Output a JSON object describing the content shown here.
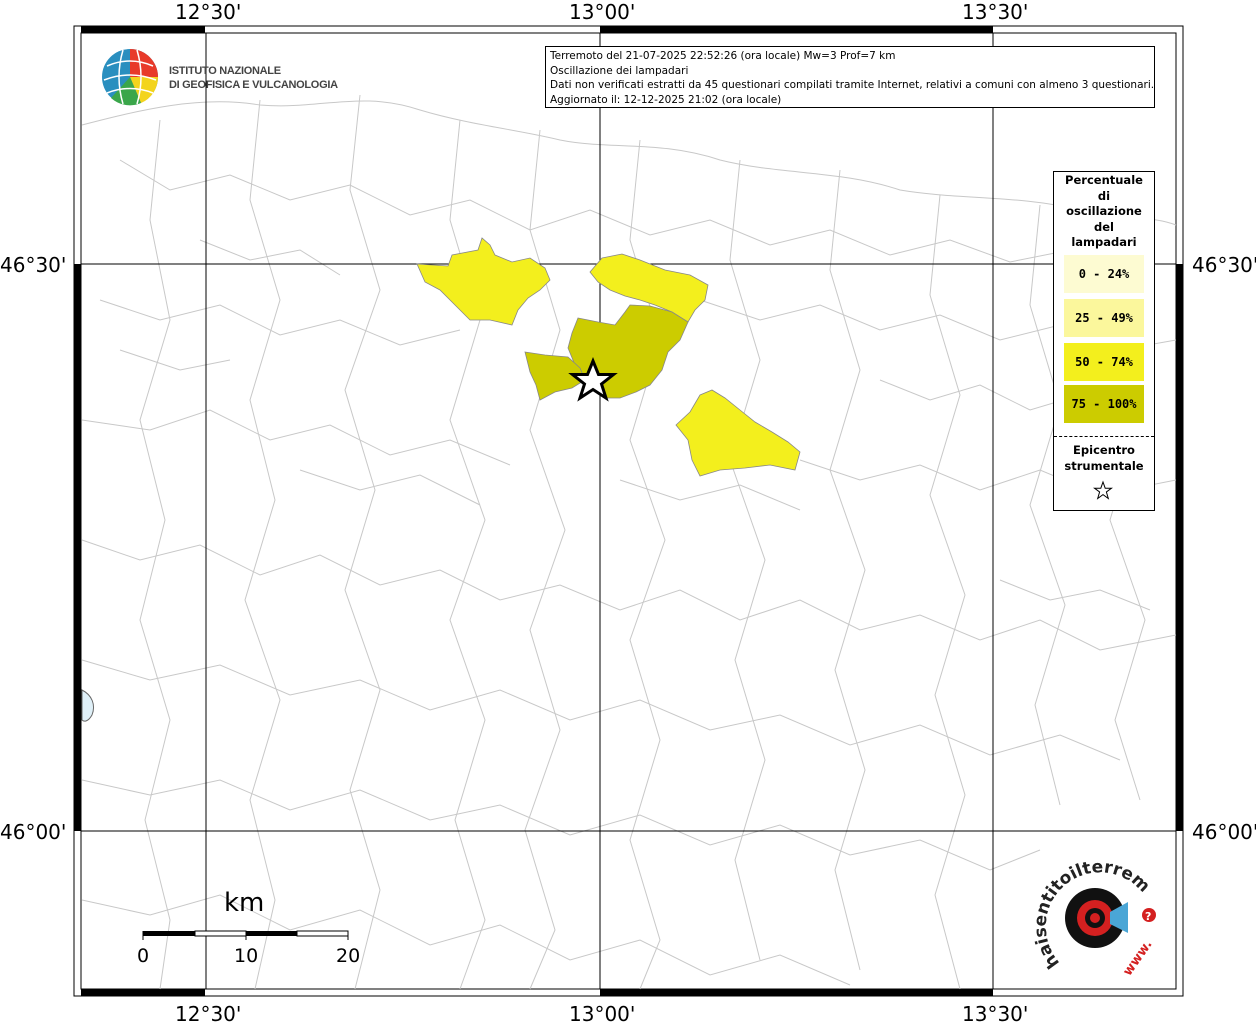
{
  "map": {
    "lon_ticks": [
      "12°30'",
      "13°00'",
      "13°30'"
    ],
    "lat_ticks": [
      "46°30'",
      "46°00'"
    ]
  },
  "info": {
    "line1": "Terremoto del 21-07-2025 22:52:26 (ora locale) Mw=3 Prof=7 km",
    "line2": "Oscillazione dei lampadari",
    "line3": "Dati non verificati estratti da 45 questionari compilati tramite Internet, relativi a comuni con almeno 3 questionari.",
    "line4": "Aggiornato il: 12-12-2025 21:02 (ora locale)"
  },
  "institute": {
    "line1": "ISTITUTO NAZIONALE",
    "line2": "DI GEOFISICA E VULCANOLOGIA"
  },
  "legend": {
    "title_lines": [
      "Percentuale",
      "di",
      "oscillazione",
      "del",
      "lampadari"
    ],
    "items": [
      {
        "label": "0 - 24%",
        "color": "#fdfbd2"
      },
      {
        "label": "25 - 49%",
        "color": "#fbf79c"
      },
      {
        "label": "50 - 74%",
        "color": "#f3ef1d"
      },
      {
        "label": "75 - 100%",
        "color": "#cccc00"
      }
    ],
    "epicenter_lines": [
      "Epicentro",
      "strumentale"
    ]
  },
  "scale": {
    "unit": "km",
    "labels": [
      "0",
      "10",
      "20"
    ]
  },
  "watermark": {
    "text": "haisentitoilterremoto.it",
    "www": "www."
  },
  "colors": {
    "class_50_74": "#f3ef1d",
    "class_75_100": "#cccc00",
    "boundaries": "#c8c8c8",
    "lake": "#dff0f8"
  }
}
